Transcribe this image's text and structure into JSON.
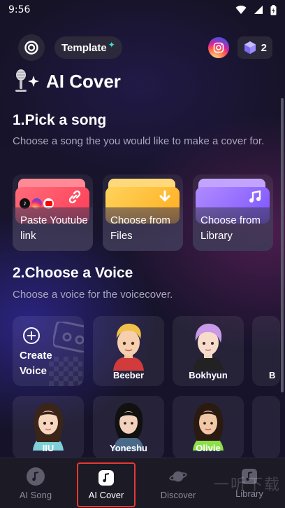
{
  "status_bar": {
    "time": "9:56"
  },
  "header": {
    "template_label": "Template",
    "credits_count": "2"
  },
  "page": {
    "title": "AI Cover"
  },
  "pick_song": {
    "title": "1.Pick a song",
    "description": "Choose a song the you would like to make a cover for.",
    "options": [
      {
        "label": "Paste Youtube link"
      },
      {
        "label": "Choose from Files"
      },
      {
        "label": "Choose from Library"
      }
    ]
  },
  "choose_voice": {
    "title": "2.Choose a Voice",
    "description": "Choose a voice for the voicecover.",
    "create_label": "Create Voice",
    "voices_row1": [
      "Beeber",
      "Bokhyun",
      "B"
    ],
    "voices_row2": [
      "IIU",
      "Yoneshu",
      "Olivie"
    ]
  },
  "tabs": [
    {
      "label": "AI Song",
      "active": false
    },
    {
      "label": "AI Cover",
      "active": true
    },
    {
      "label": "Discover",
      "active": false
    },
    {
      "label": "Library",
      "active": false
    }
  ],
  "watermark": "一听下载",
  "colors": {
    "accent_red": "#e53935",
    "folder_red": "#ff4d5e",
    "folder_yellow": "#ffc23d",
    "folder_purple": "#9a6cff"
  }
}
